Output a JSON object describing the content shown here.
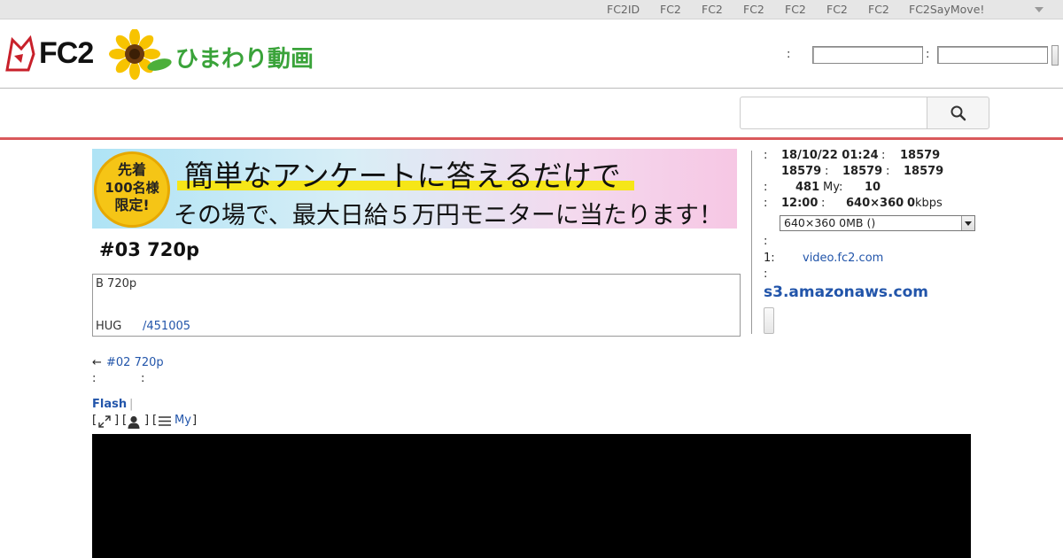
{
  "topbar": {
    "nav": [
      "FC2ID",
      "FC2",
      "FC2",
      "FC2",
      "FC2",
      "FC2",
      "FC2",
      "FC2SayMove!"
    ]
  },
  "header": {
    "logo_brand": "FC2",
    "logo_title": "ひまわり動画",
    "login_sep1": ":",
    "login_sep2": ":",
    "login_user_value": "",
    "login_pass_value": ""
  },
  "search": {
    "query": "",
    "icon": "search-icon"
  },
  "banner": {
    "badge_lines": [
      "先着",
      "100名様",
      "限定!"
    ],
    "line1": "簡単なアンケートに答えるだけで",
    "line2": "その場で、最大日給５万円モニターに当たります！"
  },
  "video": {
    "title": "#03 720p",
    "desc_line1": "B 720p",
    "desc_label": "HUG",
    "desc_link": "/451005",
    "prev_arrow": "←",
    "prev_link": "#02 720p",
    "colon_a": ":",
    "colon_b": ":"
  },
  "toolbar": {
    "flash_link": "Flash",
    "flash_sep": "|",
    "bracket_open_1": "[",
    "bracket_close_1": "]",
    "bracket_open_2": "[",
    "bracket_close_2": "]",
    "bracket_open_3": "[",
    "my_link": "My",
    "bracket_close_3": "]",
    "icons": [
      "expand-icon",
      "user-icon",
      "list-icon"
    ]
  },
  "info": {
    "row1": {
      "c1": ":",
      "date": "18/10/22 01:24",
      "c2": ":",
      "v": "18579"
    },
    "row2": {
      "v1": "18579",
      "c1": ":",
      "v2": "18579",
      "c2": ":",
      "v3": "18579"
    },
    "row3": {
      "c1": ":",
      "v1": "481",
      "label": "My:",
      "v2": "10"
    },
    "row4": {
      "c1": ":",
      "duration": "12:00",
      "c2": ":",
      "resolution": "640×360",
      "bitrate": "0",
      "unit": "kbps"
    },
    "select_value": "640×360 0MB ()",
    "colon5": ":",
    "source_label": "1:",
    "source_link": "video.fc2.com",
    "colon6": ":",
    "host": "s3.amazonaws.com"
  },
  "colors": {
    "link": "#2255aa",
    "accent_line": "#d9595b",
    "player_bg": "#000000"
  }
}
